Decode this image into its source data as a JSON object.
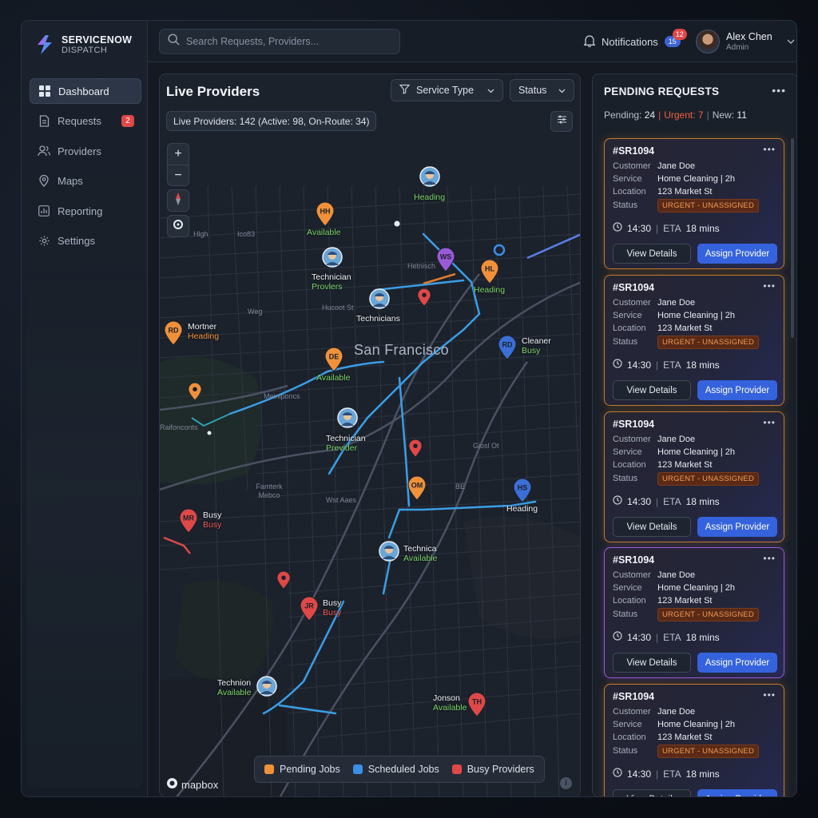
{
  "app": {
    "title": "SERVICENOW",
    "subtitle": "DISPATCH"
  },
  "sidebar": {
    "items": [
      {
        "label": "Dashboard",
        "icon": "grid-icon",
        "active": true
      },
      {
        "label": "Requests",
        "icon": "document-icon",
        "badge": "2"
      },
      {
        "label": "Providers",
        "icon": "users-icon"
      },
      {
        "label": "Maps",
        "icon": "map-pin-icon"
      },
      {
        "label": "Reporting",
        "icon": "chart-icon"
      },
      {
        "label": "Settings",
        "icon": "gear-icon"
      }
    ]
  },
  "topbar": {
    "search_placeholder": "Search Requests, Providers...",
    "notifications_label": "Notifications",
    "notif_count_blue": "15",
    "notif_count_red": "12",
    "user_name": "Alex Chen",
    "user_role": "Admin"
  },
  "map": {
    "title": "Live Providers",
    "filter_service": "Service Type",
    "filter_status": "Status",
    "summary": "Live Providers: 142 (Active: 98, On-Route: 34)",
    "city": "San Francisco",
    "attribution": "mapbox",
    "area_labels": [
      "Hlgh",
      "Ico83",
      "Hetnisch",
      "Hucoot St",
      "Weg",
      "Meinlponcs",
      "Raifonconts",
      "Famterk Mebco",
      "Wst Aaes",
      "Giosl Ot",
      "BE"
    ],
    "legend": [
      {
        "label": "Pending Jobs",
        "color": "#f0913a"
      },
      {
        "label": "Scheduled Jobs",
        "color": "#3b8ee6"
      },
      {
        "label": "Busy Providers",
        "color": "#e04848"
      }
    ],
    "markers": [
      {
        "initials": "HH",
        "line1": "",
        "line2": "Available"
      },
      {
        "initials": "",
        "line1": "",
        "line2": "Heading"
      },
      {
        "initials": "",
        "line1": "Technician",
        "line2": "Provlers"
      },
      {
        "initials": "WS",
        "line1": "",
        "line2": ""
      },
      {
        "initials": "HL",
        "line1": "",
        "line2": "Heading"
      },
      {
        "initials": "",
        "line1": "Technicians",
        "line2": ""
      },
      {
        "initials": "RD",
        "line1": "Mortner",
        "line2": "Heading"
      },
      {
        "initials": "DE",
        "line1": "",
        "line2": "Available"
      },
      {
        "initials": "RD",
        "line1": "Cleaner",
        "line2": "Busy"
      },
      {
        "initials": "",
        "line1": "Technician",
        "line2": "Previder"
      },
      {
        "initials": "OM",
        "line1": "",
        "line2": ""
      },
      {
        "initials": "HS",
        "line1": "",
        "line2": "Heading"
      },
      {
        "initials": "MR",
        "line1": "Busy",
        "line2": "Busy"
      },
      {
        "initials": "",
        "line1": "Technica",
        "line2": "Available"
      },
      {
        "initials": "JR",
        "line1": "Busy",
        "line2": "Busy"
      },
      {
        "initials": "",
        "line1": "Technion",
        "line2": "Available"
      },
      {
        "initials": "TH",
        "line1": "Jonson",
        "line2": "Available"
      }
    ]
  },
  "requests": {
    "title": "PENDING REQUESTS",
    "pending_label": "Pending:",
    "pending_value": "24",
    "urgent_label": "Urgent:",
    "urgent_value": "7",
    "new_label": "New:",
    "new_value": "11",
    "labels": {
      "customer": "Customer",
      "service": "Service",
      "location": "Location",
      "status": "Status",
      "eta": "ETA",
      "view": "View Details",
      "assign": "Assign Provider"
    },
    "cards": [
      {
        "id": "#SR1094",
        "customer": "Jane Doe",
        "service": "Home Cleaning | 2h",
        "location": "123 Market St",
        "status": "URGENT - UNASSIGNED",
        "time": "14:30",
        "eta": "18 mins",
        "accent": "orange"
      },
      {
        "id": "#SR1094",
        "customer": "Jane Doe",
        "service": "Home Cleaning | 2h",
        "location": "123 Market St",
        "status": "URGENT - UNASSIGNED",
        "time": "14:30",
        "eta": "18 mins",
        "accent": "orange"
      },
      {
        "id": "#SR1094",
        "customer": "Jane Doe",
        "service": "Home Cleaning | 2h",
        "location": "123 Market St",
        "status": "URGENT - UNASSIGNED",
        "time": "14:30",
        "eta": "18 mins",
        "accent": "orange"
      },
      {
        "id": "#SR1094",
        "customer": "Jane Doe",
        "service": "Home Cleaning | 2h",
        "location": "123 Market St",
        "status": "URGENT - UNASSIGNED",
        "time": "14:30",
        "eta": "18 mins",
        "accent": "purple"
      },
      {
        "id": "#SR1094",
        "customer": "Jane Doe",
        "service": "Home Cleaning | 2h",
        "location": "123 Market St",
        "status": "URGENT - UNASSIGNED",
        "time": "14:30",
        "eta": "18 mins",
        "accent": "orange"
      }
    ]
  }
}
